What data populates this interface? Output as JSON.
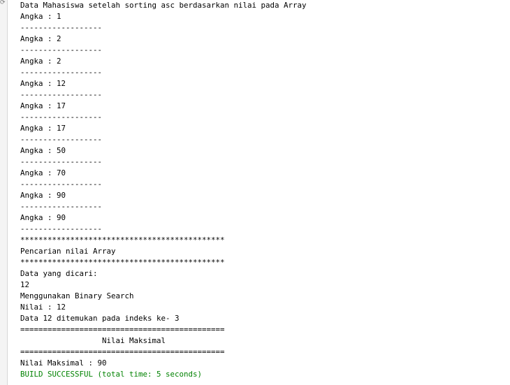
{
  "gutter": {
    "icon": "rerun-icon",
    "glyph": "⟳"
  },
  "output": {
    "lines": [
      "Data Mahasiswa setelah sorting asc berdasarkan nilai pada Array",
      "Angka : 1",
      "------------------",
      "Angka : 2",
      "------------------",
      "Angka : 2",
      "------------------",
      "Angka : 12",
      "------------------",
      "Angka : 17",
      "------------------",
      "Angka : 17",
      "------------------",
      "Angka : 50",
      "------------------",
      "Angka : 70",
      "------------------",
      "Angka : 90",
      "------------------",
      "Angka : 90",
      "------------------",
      "*********************************************",
      "Pencarian nilai Array",
      "*********************************************",
      "Data yang dicari:",
      "12",
      "Menggunakan Binary Search",
      "Nilai : 12",
      "Data 12 ditemukan pada indeks ke- 3",
      "=============================================",
      "                  Nilai Maksimal",
      "=============================================",
      "Nilai Maksimal : 90"
    ],
    "status": "BUILD SUCCESSFUL (total time: 5 seconds)"
  },
  "colors": {
    "text": "#000000",
    "success": "#008200",
    "background": "#ffffff"
  }
}
